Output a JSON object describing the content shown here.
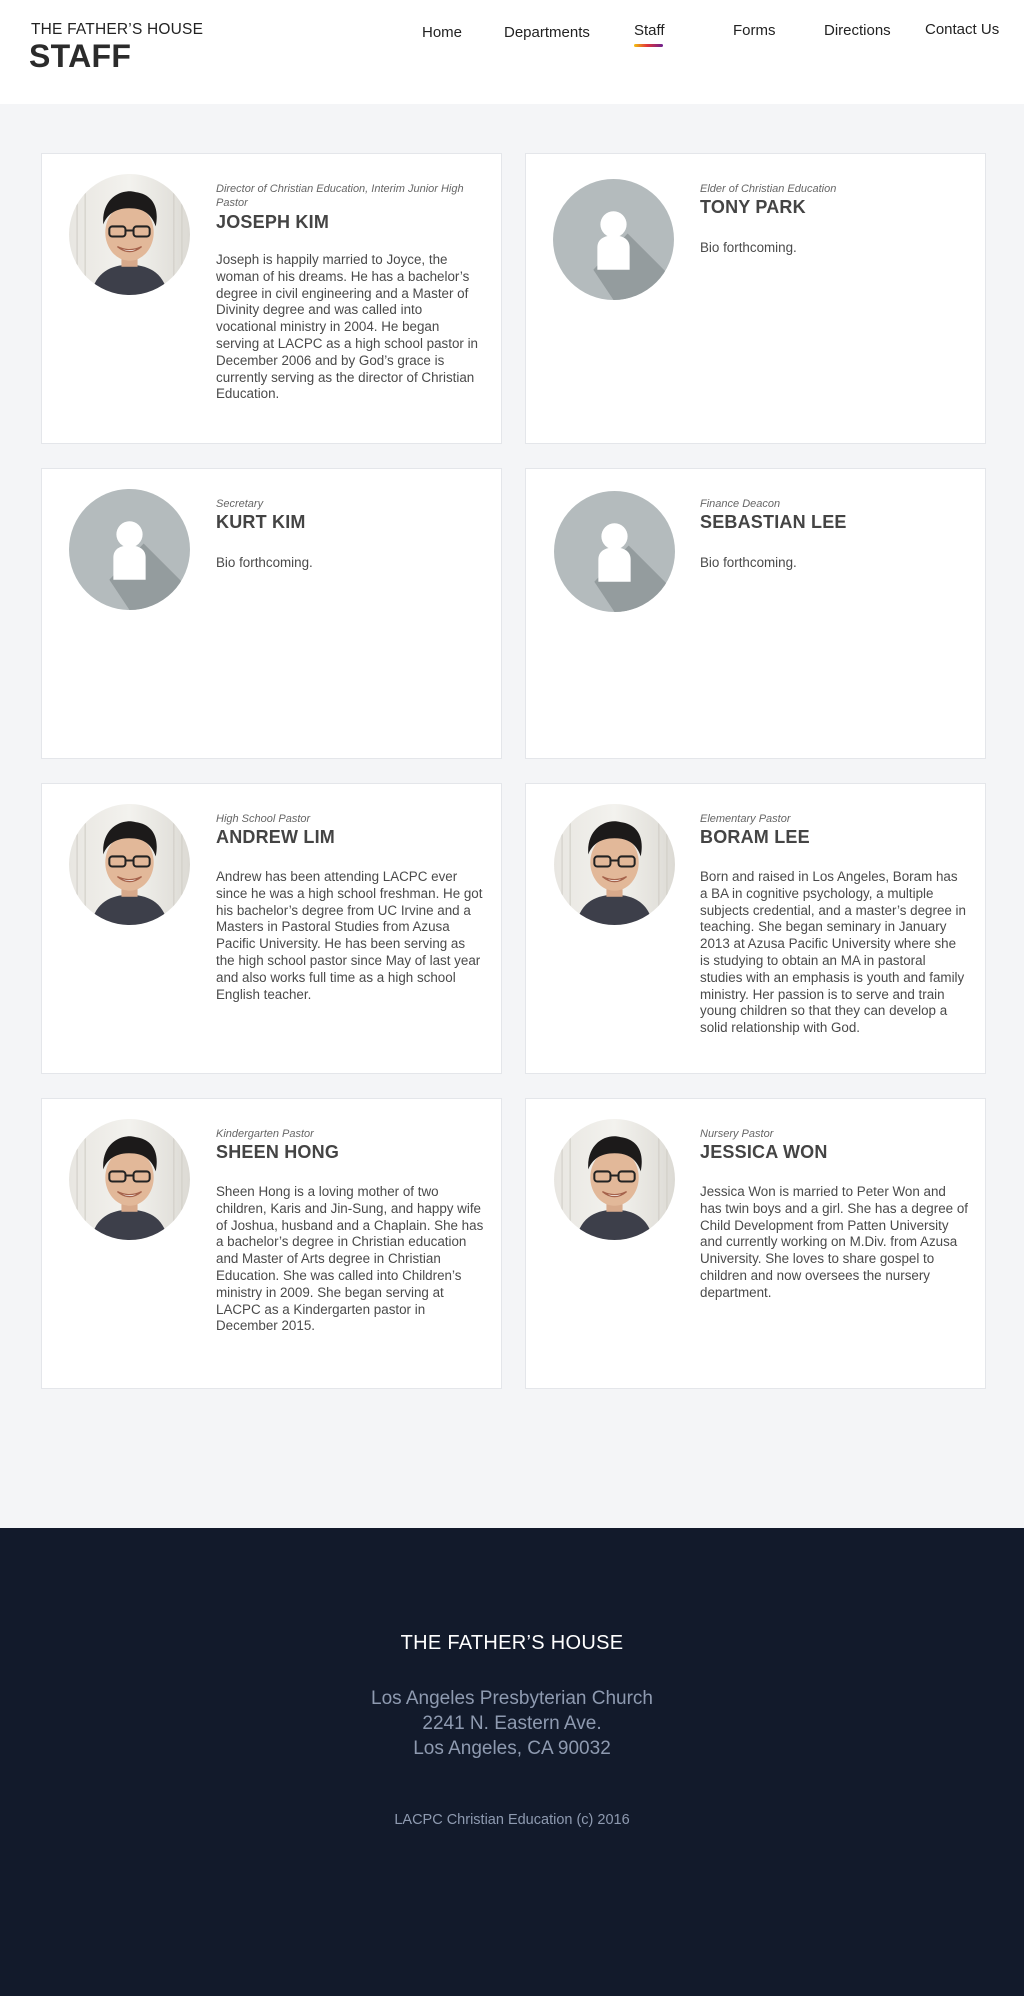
{
  "header": {
    "brand_small": "THE FATHER’S HOUSE",
    "brand_big": "STAFF",
    "nav": {
      "home": "Home",
      "departments": "Departments",
      "staff": "Staff",
      "forms": "Forms",
      "directions": "Directions",
      "contact": "Contact Us"
    },
    "active_nav": "Staff"
  },
  "staff": [
    {
      "role": "Director of Christian Education,  Interim Junior High Pastor",
      "name": "JOSEPH KIM",
      "bio": "Joseph is happily married to Joyce, the woman of his dreams. He has a bachelor’s degree in civil engineering and a Master of Divinity degree and was called into vocational ministry in 2004. He began serving at LACPC as a high school pastor in December 2006 and by God’s grace is currently serving as the director of Christian Education.",
      "photo": "portrait"
    },
    {
      "role": "Elder of Christian Education",
      "name": "TONY PARK",
      "bio": "Bio forthcoming.",
      "photo": "placeholder"
    },
    {
      "role": "Secretary",
      "name": "KURT KIM",
      "bio": "Bio forthcoming.",
      "photo": "placeholder"
    },
    {
      "role": "Finance Deacon",
      "name": "SEBASTIAN LEE",
      "bio": "Bio forthcoming.",
      "photo": "placeholder"
    },
    {
      "role": "High School Pastor",
      "name": "ANDREW LIM",
      "bio": "Andrew has been attending LACPC ever since he was a high school freshman. He got his bachelor’s degree from UC Irvine and a Masters in Pastoral Studies from Azusa Pacific University. He has been serving as the high school pastor since May of last year and also works full time as a high school English teacher.",
      "photo": "portrait"
    },
    {
      "role": "Elementary Pastor",
      "name": "BORAM LEE",
      "bio": "Born and raised in Los Angeles, Boram has a BA in cognitive psychology, a multiple subjects credential, and a master’s degree in teaching. She began seminary in January 2013 at Azusa Pacific University where she is studying to obtain an MA in pastoral studies with an emphasis is youth and family ministry. Her passion is to serve and train young children so that they can develop a solid relationship with God.",
      "photo": "portrait"
    },
    {
      "role": "Kindergarten Pastor",
      "name": "SHEEN HONG",
      "bio": "Sheen Hong is a loving mother of two children, Karis and Jin-Sung, and happy wife of Joshua, husband and a Chaplain. She has a bachelor’s degree in Christian education and Master of Arts degree in Christian Education. She was called into Children’s ministry in 2009. She began serving at LACPC as a Kindergarten pastor in December 2015.",
      "photo": "portrait"
    },
    {
      "role": "Nursery Pastor",
      "name": "JESSICA WON",
      "bio": "Jessica Won is married to Peter Won and has twin boys and a girl. She has a degree of Child Development from Patten University and currently working on M.Div. from Azusa University. She loves to share gospel to children and now oversees the nursery department.",
      "photo": "portrait"
    }
  ],
  "footer": {
    "title": "THE FATHER’S HOUSE",
    "address_line1": "Los Angeles Presbyterian Church",
    "address_line2": "2241 N. Eastern Ave.",
    "address_line3": "Los Angeles, CA 90032",
    "copyright": "LACPC Christian Education (c) 2016"
  },
  "colors": {
    "footer_bg": "#121a2b",
    "page_bg": "#f4f5f7",
    "card_bg": "#ffffff",
    "placeholder_bg": "#b4bbbd",
    "nav_underline": [
      "#f2c20f",
      "#e0353a",
      "#6c1f8f"
    ]
  }
}
